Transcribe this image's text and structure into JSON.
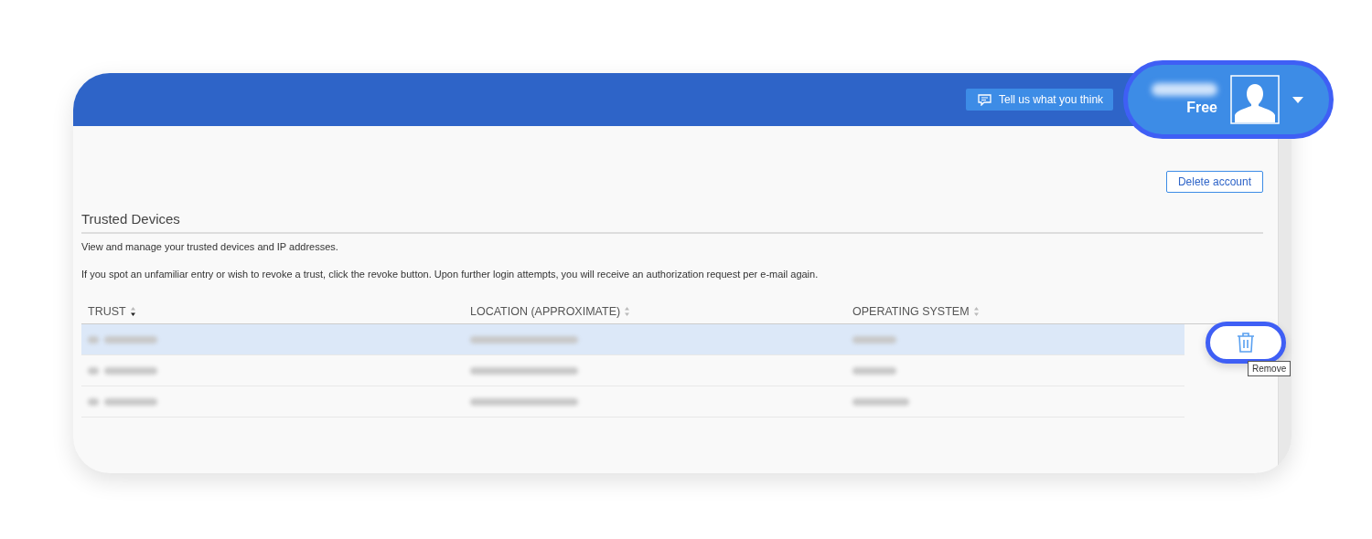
{
  "header": {
    "feedback_button": "Tell us what you think",
    "profile": {
      "plan": "Free",
      "menu_expanded": false
    }
  },
  "actions": {
    "delete_button": "Delete account"
  },
  "section": {
    "title": "Trusted Devices",
    "intro": "View and manage your trusted devices and IP addresses.",
    "note": "If you spot an unfamiliar entry or wish to revoke a trust, click the revoke button. Upon further login attempts, you will receive an authorization request per e-mail again."
  },
  "table": {
    "columns": [
      {
        "label": "TRUST",
        "sorted": true
      },
      {
        "label": "LOCATION (APPROXIMATE)",
        "sorted": false
      },
      {
        "label": "OPERATING SYSTEM",
        "sorted": false
      }
    ],
    "rows": [
      {
        "selected": true
      },
      {
        "selected": false
      },
      {
        "selected": false
      }
    ],
    "tooltip": "Remove"
  }
}
